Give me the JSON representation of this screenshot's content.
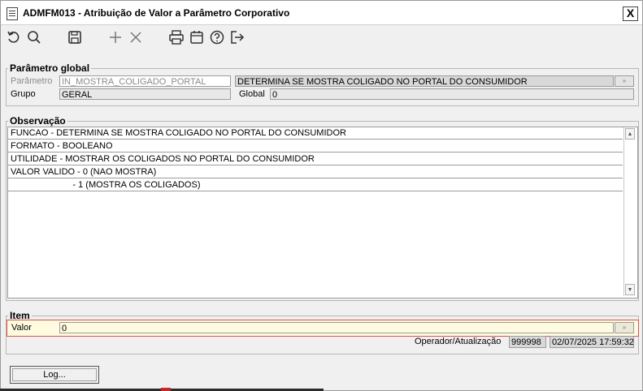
{
  "window": {
    "title": "ADMFM013 - Atribuição de Valor a Parâmetro Corporativo",
    "close_label": "X"
  },
  "toolbar": {
    "icons": [
      "undo-icon",
      "search-icon",
      "save-icon",
      "add-icon",
      "delete-icon",
      "print-icon",
      "calendar-icon",
      "help-icon",
      "exit-icon"
    ]
  },
  "parametro_global": {
    "legend": "Parâmetro global",
    "parametro_label": "Parâmetro",
    "parametro_value": "IN_MOSTRA_COLIGADO_PORTAL",
    "descricao_value": "DETERMINA SE MOSTRA COLIGADO NO PORTAL DO CONSUMIDOR",
    "grupo_label": "Grupo",
    "grupo_value": "GERAL",
    "global_label": "Global",
    "global_value": "0"
  },
  "observacao": {
    "legend": "Observação",
    "lines": [
      "FUNCAO - DETERMINA SE MOSTRA COLIGADO NO PORTAL DO CONSUMIDOR",
      "FORMATO - BOOLEANO",
      "UTILIDADE - MOSTRAR OS COLIGADOS NO PORTAL DO CONSUMIDOR",
      "VALOR VALIDO - 0 (NAO MOSTRA)",
      "                         - 1 (MOSTRA OS COLIGADOS)"
    ]
  },
  "item": {
    "legend": "Item",
    "valor_label": "Valor",
    "valor_value": "0",
    "operador_label": "Operador/Atualização",
    "operador_value": "999998",
    "atualizacao_value": "02/07/2025 17:59:32"
  },
  "footer": {
    "log_label": "Log..."
  }
}
